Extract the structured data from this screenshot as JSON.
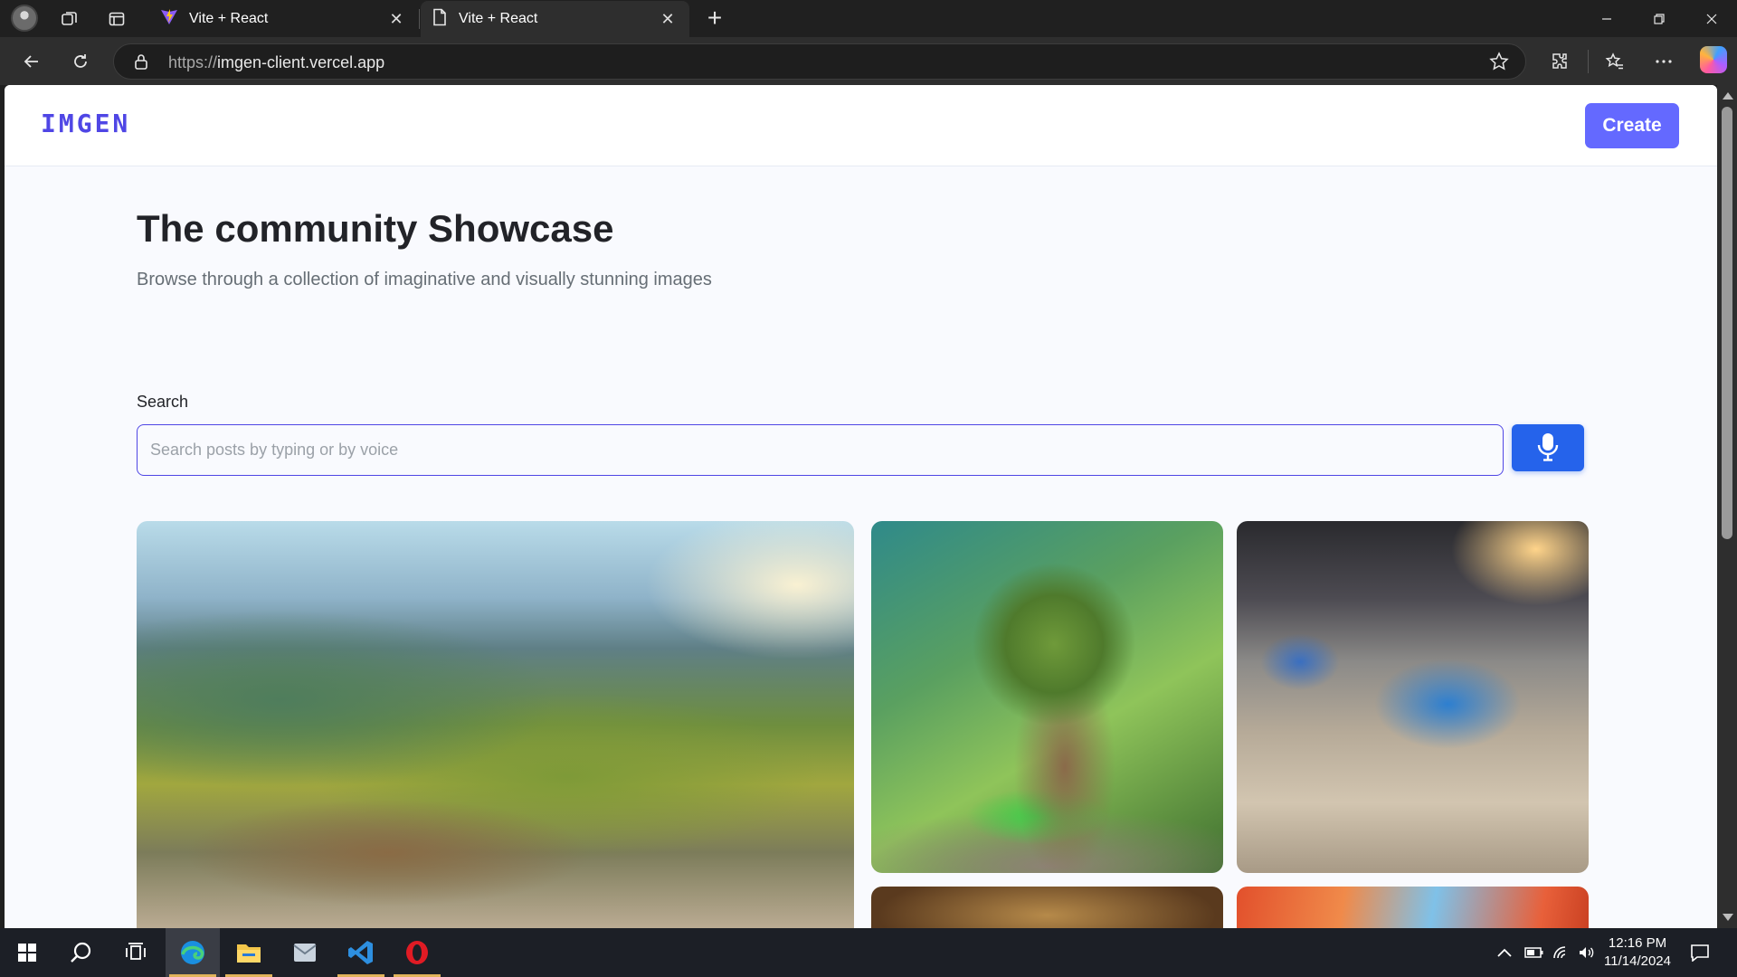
{
  "browser": {
    "tabs": [
      {
        "title": "Vite + React",
        "active": false
      },
      {
        "title": "Vite + React",
        "active": true
      }
    ],
    "url_protocol": "https://",
    "url_host": "imgen-client.vercel.app"
  },
  "site": {
    "logo": "IMGEN",
    "create_label": "Create",
    "title": "The community Showcase",
    "subtitle": "Browse through a collection of imaginative and visually stunning images",
    "search_label": "Search",
    "search_placeholder": "Search posts by typing or by voice",
    "search_value": "",
    "accent_color": "#6469ff",
    "mic_color": "#2563eb"
  },
  "gallery": [
    {
      "name": "mountain-road-cars-image"
    },
    {
      "name": "tree-on-car-image"
    },
    {
      "name": "race-car-track-image"
    },
    {
      "name": "gallery-image-4"
    },
    {
      "name": "gallery-image-5"
    }
  ],
  "taskbar": {
    "apps": [
      "start-icon",
      "search-icon",
      "task-view-icon",
      "edge-icon",
      "file-explorer-icon",
      "mail-icon",
      "vscode-icon",
      "opera-icon"
    ],
    "time": "12:16 PM",
    "date": "11/14/2024"
  }
}
